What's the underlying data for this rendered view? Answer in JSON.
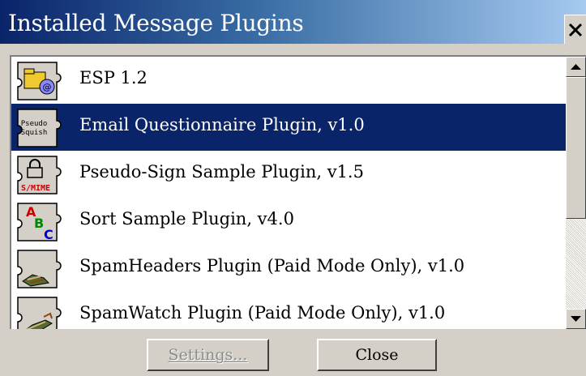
{
  "window": {
    "title": "Installed Message Plugins",
    "close_icon": "close-icon"
  },
  "plugins": [
    {
      "label": "ESP 1.2",
      "icon": "esp-plugin-icon",
      "selected": false
    },
    {
      "label": "Email Questionnaire Plugin, v1.0",
      "icon": "pseudo-squish-plugin-icon",
      "icon_text": [
        "Pseudo",
        "Squish"
      ],
      "selected": true
    },
    {
      "label": "Pseudo-Sign Sample Plugin, v1.5",
      "icon": "smime-lock-plugin-icon",
      "icon_text": [
        "S/MIME"
      ],
      "selected": false
    },
    {
      "label": "Sort Sample Plugin, v4.0",
      "icon": "abc-sort-plugin-icon",
      "icon_text": [
        "A",
        "B",
        "C"
      ],
      "selected": false
    },
    {
      "label": "SpamHeaders Plugin (Paid Mode Only), v1.0",
      "icon": "spam-headers-plugin-icon",
      "selected": false
    },
    {
      "label": "SpamWatch Plugin (Paid Mode Only), v1.0",
      "icon": "spam-watch-plugin-icon",
      "selected": false
    }
  ],
  "buttons": {
    "settings": "Settings...",
    "close": "Close",
    "settings_enabled": false
  },
  "scrollbar": {
    "up_icon": "scroll-up-arrow-icon",
    "down_icon": "scroll-down-arrow-icon"
  },
  "colors": {
    "selection": "#0a246a",
    "titlebar_start": "#0a246a",
    "titlebar_end": "#a6caf0"
  }
}
